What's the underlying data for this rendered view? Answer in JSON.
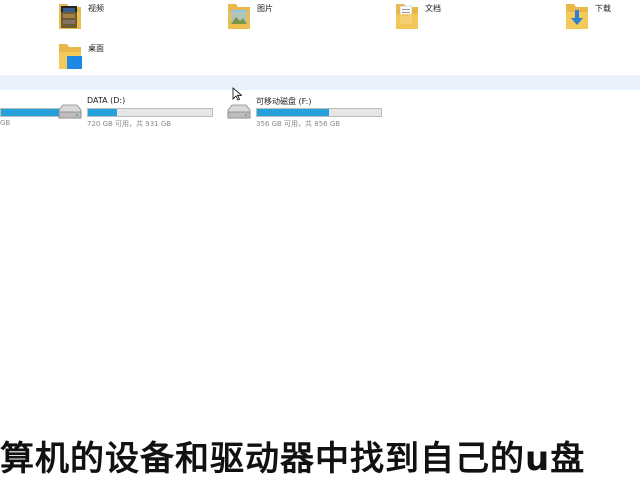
{
  "folders": [
    {
      "label": "视频",
      "icon": "video-folder-icon"
    },
    {
      "label": "图片",
      "icon": "pictures-folder-icon"
    },
    {
      "label": "文档",
      "icon": "documents-folder-icon"
    },
    {
      "label": "下载",
      "icon": "downloads-folder-icon"
    },
    {
      "label": "桌面",
      "icon": "desktop-folder-icon"
    }
  ],
  "drives": [
    {
      "name": "",
      "capacity": "GB",
      "used_fraction": 1.0
    },
    {
      "name": "DATA (D:)",
      "capacity": "720 GB 可用，共 931 GB",
      "used_fraction": 0.23
    },
    {
      "name": "可移动磁盘 (F:)",
      "capacity": "356 GB 可用，共 856 GB",
      "used_fraction": 0.58
    }
  ],
  "caption": "算机的设备和驱动器中找到自己的u盘",
  "colors": {
    "progress": "#26a0da",
    "band": "#e9f2fc"
  }
}
